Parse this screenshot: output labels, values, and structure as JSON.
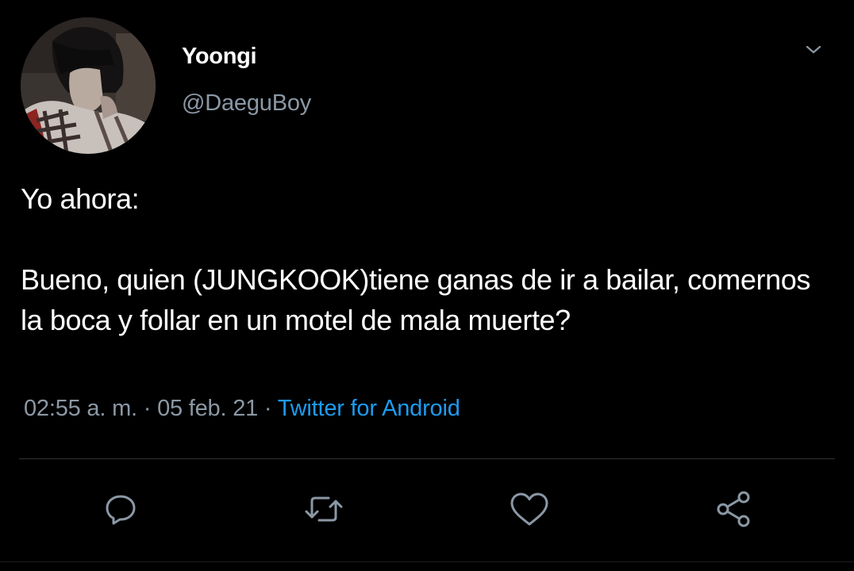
{
  "user": {
    "display_name": "Yoongi",
    "handle": "@DaeguBoy",
    "avatar_icon": "profile-photo"
  },
  "tweet": {
    "line1": "Yo ahora:",
    "line2": "Bueno, quien (JUNGKOOK)tiene ganas de ir a bailar, comernos la boca y follar en un motel de mala muerte?"
  },
  "meta": {
    "time": "02:55 a. m.",
    "separator": " · ",
    "date": "05 feb. 21",
    "source": "Twitter for Android"
  },
  "actions": [
    {
      "icon": "reply-icon"
    },
    {
      "icon": "retweet-icon"
    },
    {
      "icon": "like-icon"
    },
    {
      "icon": "share-icon"
    }
  ],
  "colors": {
    "background": "#000000",
    "text": "#ffffff",
    "secondary": "#8b98a5",
    "accent": "#1d9bf0",
    "divider": "#2f3336"
  }
}
